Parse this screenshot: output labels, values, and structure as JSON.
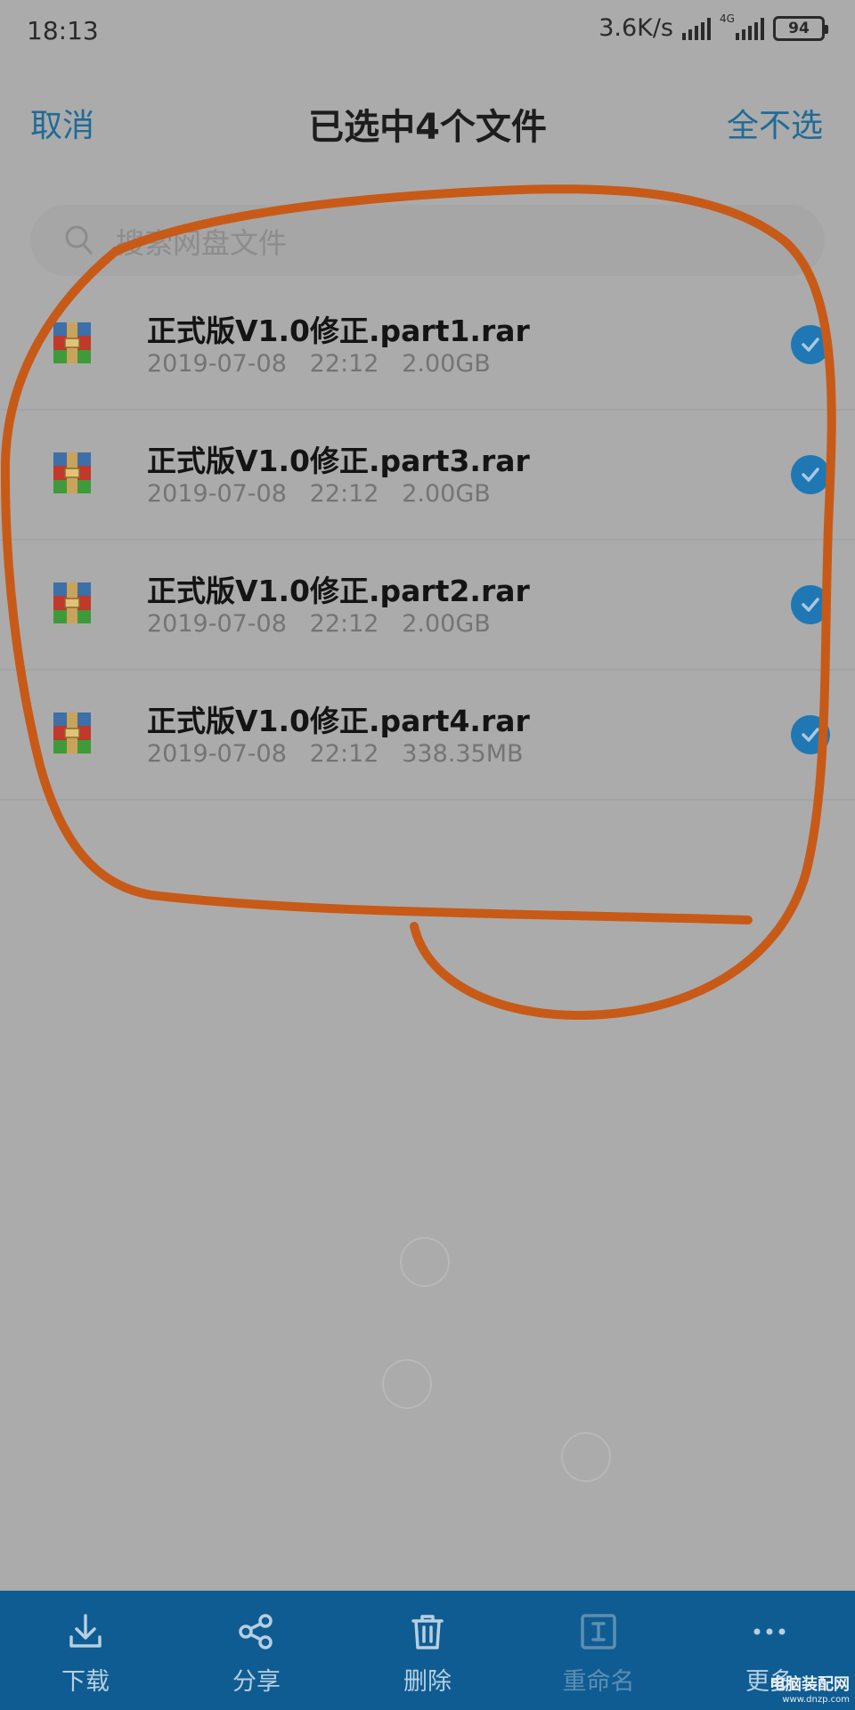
{
  "status_bar": {
    "time": "18:13",
    "net_speed": "3.6K/s",
    "network_type": "4G",
    "battery": "94"
  },
  "header": {
    "cancel_label": "取消",
    "title": "已选中4个文件",
    "deselect_all_label": "全不选"
  },
  "search": {
    "placeholder": "搜索网盘文件",
    "icon": "search-icon"
  },
  "files": [
    {
      "name": "正式版V1.0修正.part1.rar",
      "date": "2019-07-08",
      "time": "22:12",
      "size": "2.00GB",
      "checked": true
    },
    {
      "name": "正式版V1.0修正.part3.rar",
      "date": "2019-07-08",
      "time": "22:12",
      "size": "2.00GB",
      "checked": true
    },
    {
      "name": "正式版V1.0修正.part2.rar",
      "date": "2019-07-08",
      "time": "22:12",
      "size": "2.00GB",
      "checked": true
    },
    {
      "name": "正式版V1.0修正.part4.rar",
      "date": "2019-07-08",
      "time": "22:12",
      "size": "338.35MB",
      "checked": true
    }
  ],
  "toolbar": {
    "download_label": "下载",
    "share_label": "分享",
    "delete_label": "删除",
    "rename_label": "重命名",
    "more_label": "更多"
  },
  "watermark": {
    "main": "电脑装配网",
    "sub": "www.dnzp.com"
  },
  "colors": {
    "accent": "#1f78b4",
    "toolbar_bg": "#0f5c92",
    "annotation": "#c85a17"
  }
}
